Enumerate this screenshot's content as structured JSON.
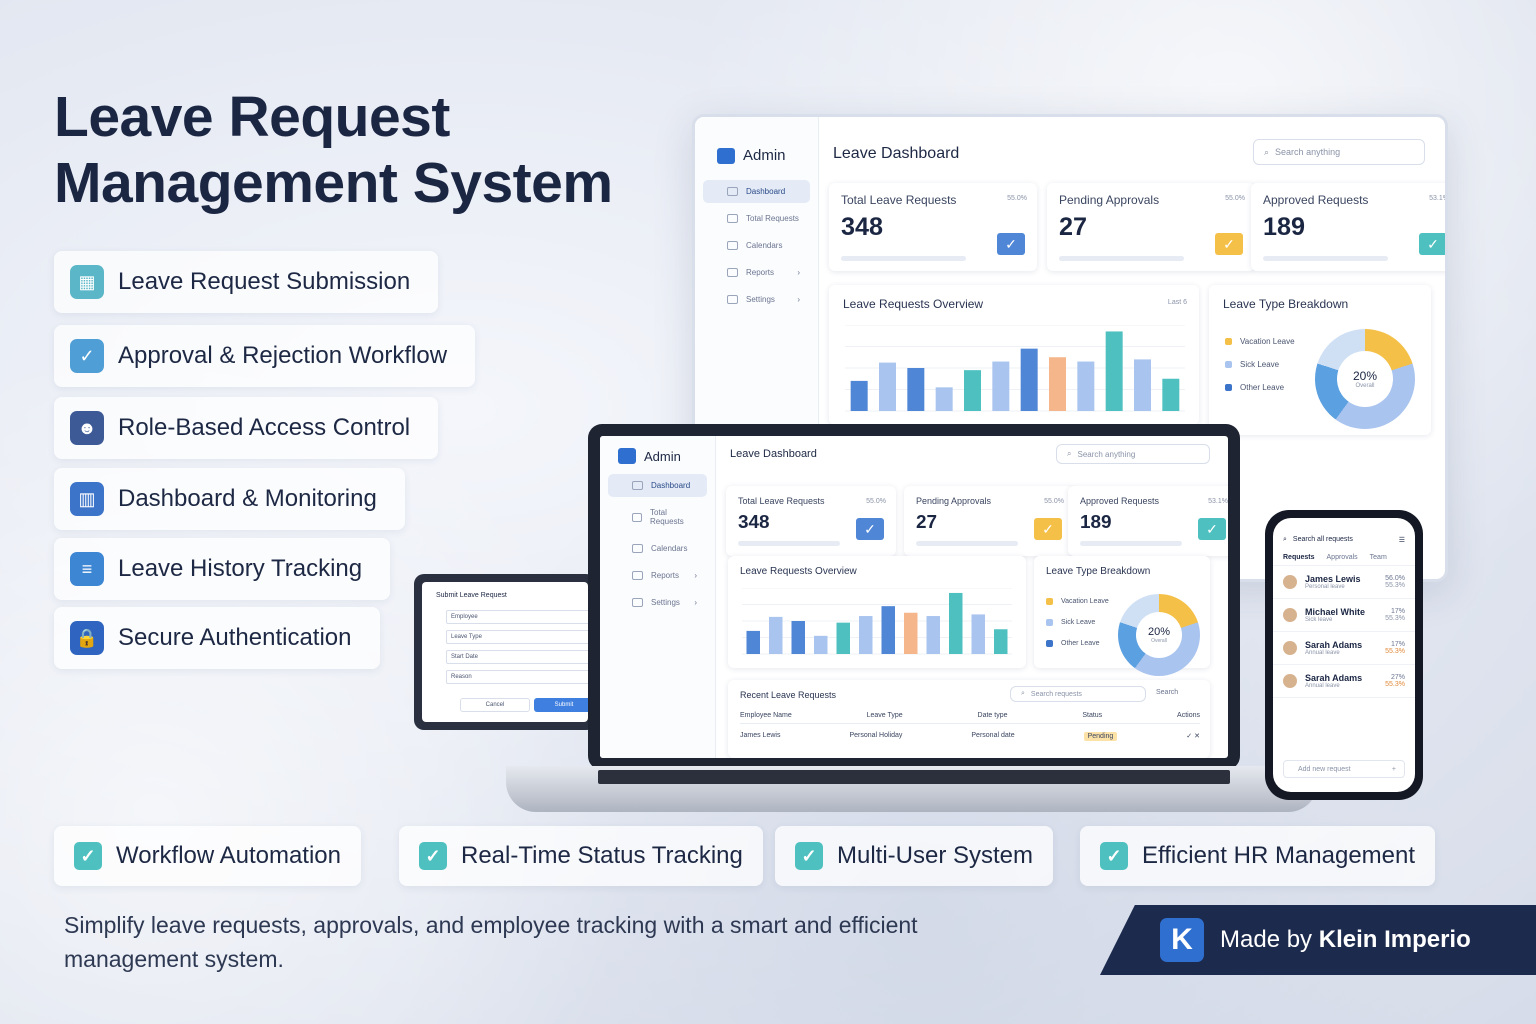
{
  "title_line1": "Leave Request",
  "title_line2": "Management System",
  "features": [
    {
      "label": "Leave Request Submission",
      "icon": "calendar-icon",
      "color": "#5bb7c8"
    },
    {
      "label": "Approval & Rejection Workflow",
      "icon": "checkbox-icon",
      "color": "#4f9fd6"
    },
    {
      "label": "Role-Based Access Control",
      "icon": "users-icon",
      "color": "#3d5a96"
    },
    {
      "label": "Dashboard & Monitoring",
      "icon": "dashboard-icon",
      "color": "#3b74c8"
    },
    {
      "label": "Leave History Tracking",
      "icon": "history-icon",
      "color": "#3d86d4"
    },
    {
      "label": "Secure Authentication",
      "icon": "lock-icon",
      "color": "#2f65c0"
    }
  ],
  "checks": [
    "Workflow Automation",
    "Real-Time Status Tracking",
    "Multi-User System",
    "Efficient HR Management"
  ],
  "tagline": "Simplify leave requests, approvals, and employee tracking with a smart and efficient management system.",
  "brand": {
    "prefix": "Made by",
    "name": "Klein Imperio",
    "logo": "K"
  },
  "dashboard": {
    "admin": "Admin",
    "heading": "Leave Dashboard",
    "search_placeholder": "Search anything",
    "nav": [
      "Dashboard",
      "Total Requests",
      "Calendars",
      "Reports",
      "Settings"
    ],
    "cards": [
      {
        "label": "Total Leave Requests",
        "value": "348",
        "pct": "55.0%",
        "color": "#4f86d6"
      },
      {
        "label": "Pending Approvals",
        "value": "27",
        "pct": "55.0%",
        "color": "#f4c048"
      },
      {
        "label": "Approved Requests",
        "value": "189",
        "pct": "53.1%",
        "color": "#4fc0c0"
      }
    ],
    "overview_title": "Leave Requests Overview",
    "overview_filter": "Last 6",
    "breakdown_title": "Leave Type Breakdown",
    "legend": [
      {
        "label": "Vacation Leave",
        "color": "#f4c048"
      },
      {
        "label": "Sick Leave",
        "color": "#a9c4ef"
      },
      {
        "label": "Other Leave",
        "color": "#3b74c8"
      }
    ],
    "donut_value": "20%",
    "donut_caption": "Overall",
    "recent_title": "Recent Leave Requests",
    "recent_search": "Search requests",
    "recent_filter": "Search",
    "table_headers": [
      "Employee Name",
      "Leave Type",
      "Date type",
      "Status",
      "Actions"
    ],
    "table_row": {
      "name": "James Lewis",
      "type": "Personal Holiday",
      "date": "Personal date",
      "status": "Pending"
    }
  },
  "chart_data": {
    "type": "bar",
    "values": [
      28,
      45,
      40,
      22,
      38,
      46,
      58,
      50,
      46,
      74,
      48,
      30
    ],
    "colors": [
      "#4f86d6",
      "#a9c4ef",
      "#4f86d6",
      "#a9c4ef",
      "#4fc0c0",
      "#a9c4ef",
      "#4f86d6",
      "#f4b68a",
      "#a9c4ef",
      "#4fc0c0",
      "#a9c4ef",
      "#4fc0c0"
    ],
    "ylim": [
      0,
      80
    ]
  },
  "tablet": {
    "title": "Submit Leave Request",
    "fields": [
      "Employee",
      "Leave Type",
      "Start Date",
      "Reason"
    ],
    "cancel": "Cancel",
    "submit": "Submit"
  },
  "phone": {
    "header": "Search all requests",
    "tabs": [
      "Requests",
      "Approvals",
      "Team"
    ],
    "rows": [
      {
        "name": "James Lewis",
        "sub": "Personal leave",
        "pct": "56.0%",
        "pct2": "55.3%"
      },
      {
        "name": "Michael White",
        "sub": "Sick leave",
        "pct": "17%",
        "pct2": "55.3%"
      },
      {
        "name": "Sarah Adams",
        "sub": "Annual leave",
        "pct": "17%",
        "pct2": "55.3%"
      },
      {
        "name": "Sarah Adams",
        "sub": "Annual leave",
        "pct": "27%",
        "pct2": "55.3%"
      }
    ],
    "footer": "Add new request"
  }
}
